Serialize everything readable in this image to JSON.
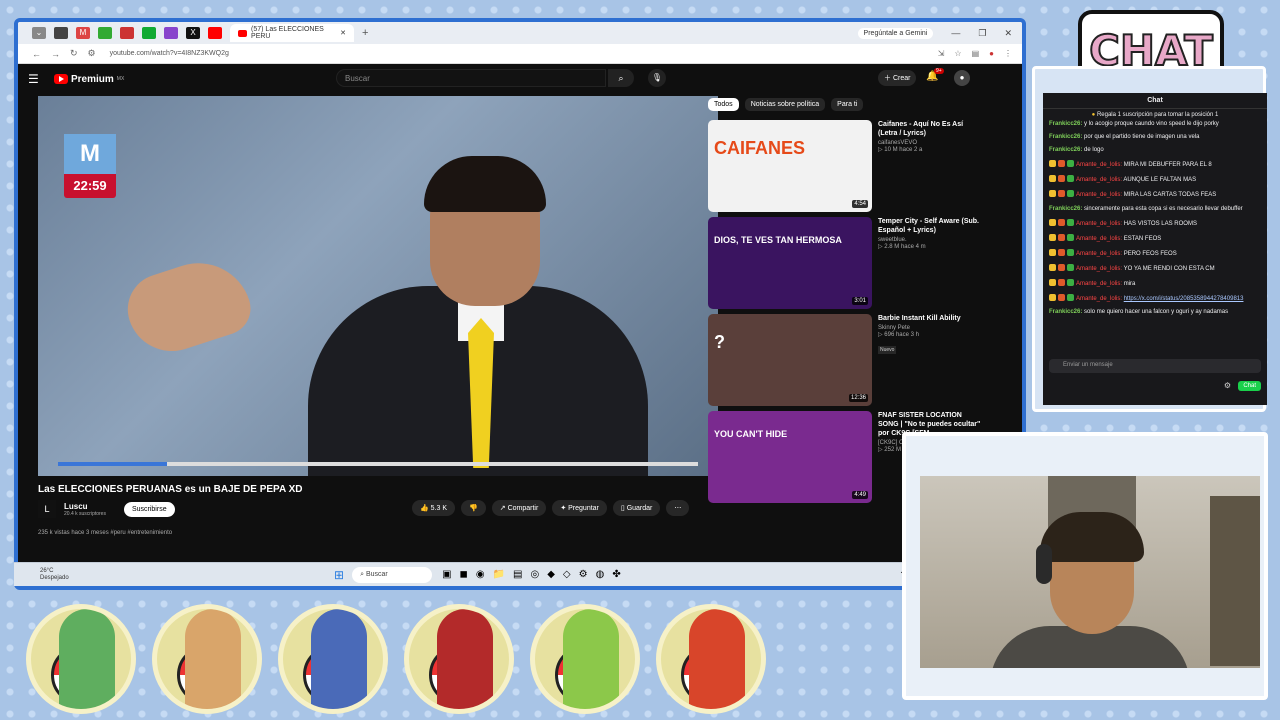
{
  "browser": {
    "active_tab": "(57) Las ELECCIONES PERU",
    "gemini": "Pregúntale a Gemini",
    "url": "youtube.com/watch?v=4I8NZ3KWQ2g"
  },
  "youtube": {
    "logo": "Premium",
    "logo_region": "MX",
    "search_placeholder": "Buscar",
    "create": "Crear",
    "notifications": "9+",
    "video": {
      "channel_badge_time": "22:59",
      "title": "Las ELECCIONES PERUANAS es un BAJE DE PEPA XD",
      "channel": "Luscu",
      "channel_initial": "L",
      "subscribers": "20.4 k suscriptores",
      "subscribe": "Suscribirse",
      "likes": "5.3 K",
      "share": "Compartir",
      "ask": "Preguntar",
      "save": "Guardar",
      "more": "⋯",
      "views": "235 k vistas  hace 3 meses  #peru #entretenimiento",
      "progress": 0.17
    },
    "chips": [
      "Todos",
      "Noticias sobre política",
      "Para ti"
    ],
    "recommendations": [
      {
        "title": "Caifanes - Aquí No Es Así (Letra / Lyrics)",
        "channel": "caifanesVEVO",
        "meta": "▷ 10 M  hace 2 a",
        "duration": "4:54",
        "thumb_text": "CAIFANES",
        "bg": "#f2f2f2",
        "fg": "#e64a19"
      },
      {
        "title": "Temper City - Self Aware (Sub. Español + Lyrics)",
        "channel": "sweetblue.",
        "meta": "▷ 2.8 M  hace 4 m",
        "duration": "3:01",
        "thumb_text": "DIOS, TE VES TAN HERMOSA",
        "bg": "#3a1460",
        "fg": "#ffffff"
      },
      {
        "title": "Barbie Instant Kill Ability",
        "channel": "Skinny Pete",
        "meta": "▷ 696  hace 3 h",
        "badge": "Nuevo",
        "duration": "12:36",
        "thumb_text": "?",
        "bg": "#5a3f3a",
        "fg": "#ffffff"
      },
      {
        "title": "FNAF SISTER LOCATION SONG | \"No te puedes ocultar\" por CK9C [SFM ...",
        "channel": "[CK9C] ChaoticCanineCulture",
        "meta": "▷ 252 M  hace 6 a",
        "duration": "4:49",
        "thumb_text": "YOU CAN'T HIDE",
        "bg": "#7a2a8f",
        "fg": "#ffffff"
      }
    ]
  },
  "taskbar": {
    "weather_temp": "26°C",
    "weather_desc": "Despejado",
    "search": "Buscar"
  },
  "chat": {
    "logo": "CHAT",
    "header": "Chat",
    "pinned": "Regala 1 suscripción para tomar la posición 1",
    "messages": [
      {
        "user": "Frankicc26:",
        "text": "y lo acogio proque caundo vino speed le dijo porky",
        "kind": "u1"
      },
      {
        "user": "Frankicc26:",
        "text": "por que el partido tiene de imagen una vela",
        "kind": "u1"
      },
      {
        "user": "Frankicc26:",
        "text": "de logo",
        "kind": "u1"
      },
      {
        "user": "Amante_de_lolis:",
        "text": "MIRA MI DEBUFFER PARA EL 8",
        "kind": "u2"
      },
      {
        "user": "Amante_de_lolis:",
        "text": "AUNQUE LE FALTAN MAS",
        "kind": "u2"
      },
      {
        "user": "Amante_de_lolis:",
        "text": "MIRA LAS CARTAS TODAS FEAS",
        "kind": "u2"
      },
      {
        "user": "Frankicc26:",
        "text": "sinceramente para esta copa si es necesario llevar debuffer",
        "kind": "u1"
      },
      {
        "user": "Amante_de_lolis:",
        "text": "HAS VISTOS LAS ROOMS",
        "kind": "u2"
      },
      {
        "user": "Amante_de_lolis:",
        "text": "ESTAN FEOS",
        "kind": "u2"
      },
      {
        "user": "Amante_de_lolis:",
        "text": "PERO FEOS FEOS",
        "kind": "u2"
      },
      {
        "user": "Amante_de_lolis:",
        "text": "YO YA ME RENDI CON ESTA CM",
        "kind": "u2"
      },
      {
        "user": "Amante_de_lolis:",
        "text": "mira",
        "kind": "u2"
      },
      {
        "user": "Amante_de_lolis:",
        "text": "https://x.com/i/status/2085358944278409813",
        "kind": "u2link"
      },
      {
        "user": "Frankicc26:",
        "text": "solo me quiero hacer una falcon y oguri y ay nadamas",
        "kind": "u1"
      }
    ],
    "input_placeholder": "Enviar un mensaje",
    "send": "Chat"
  },
  "colors": {
    "accent": "#2e6fd1",
    "yt_red": "#ff0000",
    "chat_green": "#1ad04b"
  }
}
